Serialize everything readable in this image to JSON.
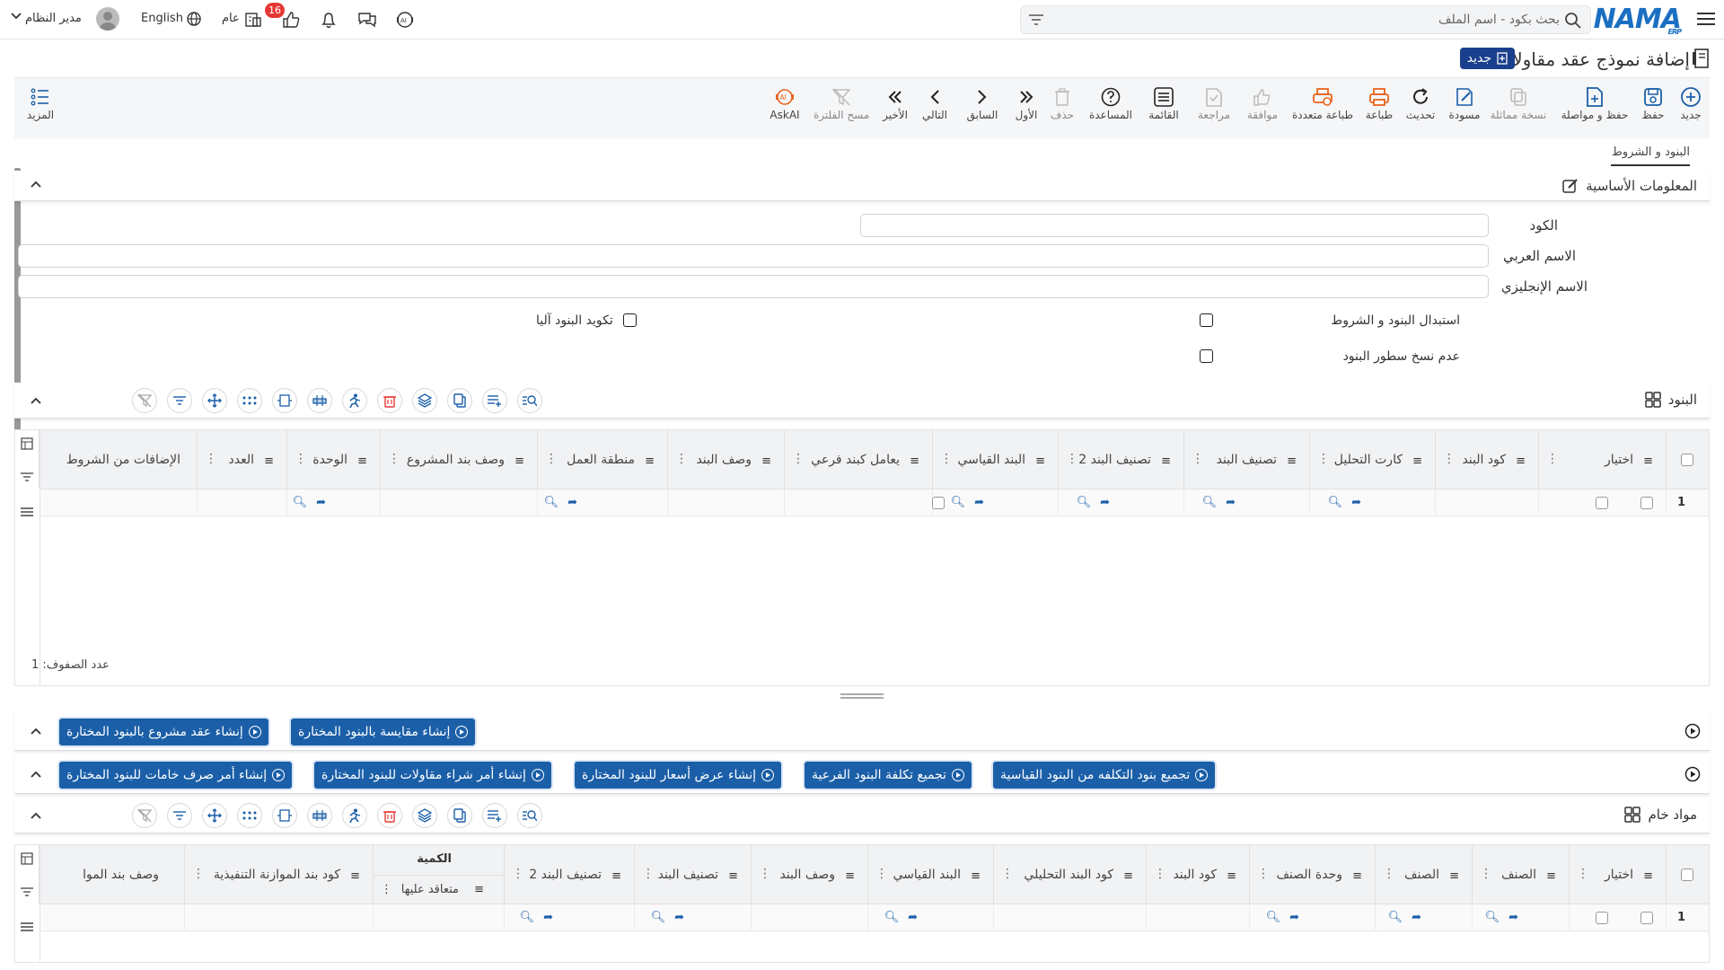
{
  "topbar": {
    "search_placeholder": "بحث بكود - اسم الملف",
    "logo": "NAMA",
    "logo_sub": "ERP",
    "user_name": "مدير النظام",
    "language": "English",
    "scope": "عام",
    "notification_count": "16"
  },
  "header": {
    "title": "إضافة نموذج عقد مقاولات",
    "new_badge": "جديد"
  },
  "toolbar": {
    "new": "جديد",
    "save": "حفظ",
    "save_continue": "حفظ و مواصلة",
    "duplicate": "نسخة مماثلة",
    "draft": "مسودة",
    "refresh": "تحديث",
    "print": "طباعة",
    "multi_print": "طباعة متعددة",
    "approve": "موافقة",
    "review": "مراجعة",
    "list": "القائمة",
    "help": "المساعدة",
    "delete": "حذف",
    "first": "الأول",
    "previous": "السابق",
    "next": "التالي",
    "last": "الأخير",
    "clear_filter": "مسح الفلترة",
    "askai": "AskAI",
    "more": "المزيد"
  },
  "tabs": {
    "terms": "البنود و الشروط"
  },
  "basic_info": {
    "title": "المعلومات الأساسية",
    "code_label": "الكود",
    "code_value": "",
    "arabic_name_label": "الاسم العربي",
    "arabic_name_value": "",
    "english_name_label": "الاسم الإنجليزي",
    "english_name_value": "",
    "replace_terms_label": "استبدال البنود و الشروط",
    "auto_code_label": "تكويد البنود آليا",
    "no_copy_lines_label": "عدم نسخ سطور البنود"
  },
  "items_section": {
    "title": "البنود",
    "columns": [
      "اختيار",
      "كود البند",
      "كارت التحليل",
      "تصنيف البند",
      "تصنيف البند 2",
      "البند القياسي",
      "يعامل كبند فرعي",
      "وصف البند",
      "منطقة العمل",
      "وصف بند المشروع",
      "الوحدة",
      "العدد",
      "الإضافات من الشروط"
    ],
    "row_number": "1",
    "row_count_label": "عدد الصفوف:",
    "row_count": "1"
  },
  "action_bar_1": {
    "create_comparison": "إنشاء مقايسة بالبنود المختارة",
    "create_project_contract": "إنشاء عقد مشروع بالبنود المختارة"
  },
  "action_bar_2": {
    "aggregate_standard": "تجميع بنود التكلفه من البنود القياسية",
    "aggregate_sub": "تجميع تكلفة البنود الفرعية",
    "create_quote": "إنشاء عرض أسعار للبنود المختارة",
    "create_po": "إنشاء أمر شراء مقاولات للبنود المختارة",
    "create_issue": "إنشاء أمر صرف خامات للبنود المختارة"
  },
  "raw_section": {
    "title": "مواد خام",
    "columns": [
      "اختيار",
      "الصنف",
      "الصنف",
      "وحدة الصنف",
      "كود البند",
      "كود البند التحليلي",
      "البند القياسي",
      "وصف البند",
      "تصنيف البند",
      "تصنيف البند 2",
      "الكمية",
      "كود بند الموازنة التنفيذية",
      "وصف بند الموا"
    ],
    "quantity_sub": "متعاقد عليها",
    "row_number": "1"
  },
  "colors": {
    "primary": "#1b5fa8",
    "badge": "#1a3f8c",
    "orange": "#e8631c",
    "notification": "#e53935"
  }
}
